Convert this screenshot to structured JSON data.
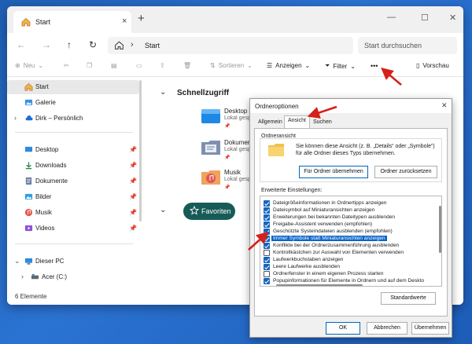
{
  "window": {
    "tab_title": "Start",
    "new_tab": "+",
    "close_tab": "×"
  },
  "nav": {
    "path": "Start",
    "search_placeholder": "Start durchsuchen"
  },
  "toolbar": {
    "new_label": "Neu",
    "sort_label": "Sortieren",
    "view_label": "Anzeigen",
    "filter_label": "Filter",
    "more_label": "•••",
    "preview_label": "Vorschau"
  },
  "sidebar": {
    "items": [
      {
        "label": "Start",
        "icon": "home-icon"
      },
      {
        "label": "Galerie",
        "icon": "gallery-icon"
      },
      {
        "label": "Dirk – Persönlich",
        "icon": "cloud-icon"
      },
      {
        "label": "Desktop",
        "icon": "desktop-icon"
      },
      {
        "label": "Downloads",
        "icon": "download-icon"
      },
      {
        "label": "Dokumente",
        "icon": "documents-icon"
      },
      {
        "label": "Bilder",
        "icon": "pictures-icon"
      },
      {
        "label": "Musik",
        "icon": "music-icon"
      },
      {
        "label": "Videos",
        "icon": "videos-icon"
      },
      {
        "label": "Dieser PC",
        "icon": "pc-icon"
      },
      {
        "label": "Acer (C:)",
        "icon": "drive-icon"
      }
    ]
  },
  "content": {
    "quick_access_title": "Schnellzugriff",
    "items": [
      {
        "name": "Desktop",
        "sub": "Lokal gespeichert"
      },
      {
        "name": "Dokumente",
        "sub": "Lokal gespeichert"
      },
      {
        "name": "Musik",
        "sub": "Lokal gespeichert"
      }
    ],
    "favorites_label": "Favoriten"
  },
  "status": {
    "count": "6 Elemente"
  },
  "dialog": {
    "title": "Ordneroptionen",
    "tabs": [
      "Allgemein",
      "Ansicht",
      "Suchen"
    ],
    "folder_view_label": "Ordneransicht",
    "folder_view_desc": "Sie können diese Ansicht (z. B. „Details“ oder „Symbole“) für alle Ordner dieses Typs übernehmen.",
    "apply_button": "Für Ordner übernehmen",
    "reset_button": "Ordner zurücksetzen",
    "advanced_label": "Erweiterte Einstellungen:",
    "settings": [
      {
        "label": "Dateigrößeinformationen in Ordnertipps anzeigen",
        "checked": true
      },
      {
        "label": "Dateisymbol auf Miniaturansichten anzeigen",
        "checked": true
      },
      {
        "label": "Erweiterungen bei bekannten Dateitypen ausblenden",
        "checked": true
      },
      {
        "label": "Freigabe-Assistent verwenden (empfohlen)",
        "checked": true
      },
      {
        "label": "Geschützte Systemdateien ausblenden (empfohlen)",
        "checked": true
      },
      {
        "label": "Immer Symbole statt Miniaturansichten anzeigen",
        "checked": true
      },
      {
        "label": "Konflikte bei der Ordnerzusammenführung ausblenden",
        "checked": true
      },
      {
        "label": "Kontrollkästchen zur Auswahl von Elementen verwenden",
        "checked": false
      },
      {
        "label": "Laufwerkbuchstaben anzeigen",
        "checked": true
      },
      {
        "label": "Leere Laufwerke ausblenden",
        "checked": true
      },
      {
        "label": "Ordnerfenster in einem eigenen Prozess starten",
        "checked": false
      },
      {
        "label": "Popupinformationen für Elemente in Ordnern und auf dem Deskto",
        "checked": true
      }
    ],
    "defaults_button": "Standardwerte",
    "ok_button": "OK",
    "cancel_button": "Abbrechen",
    "apply_all_button": "Übernehmen"
  },
  "colors": {
    "accent": "#0a64c8",
    "favorites_bg": "#175b57",
    "annotation_arrow": "#d6201b",
    "desktop_bg": "#2b73d2"
  }
}
